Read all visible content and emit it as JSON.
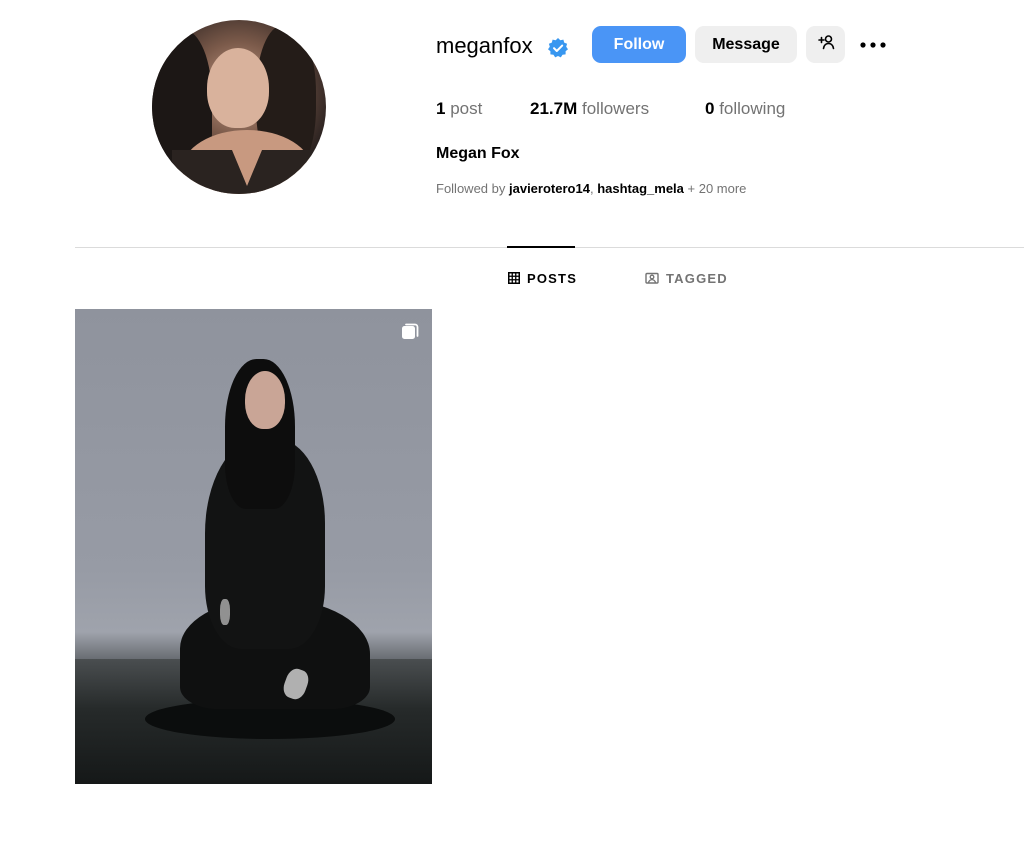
{
  "profile": {
    "username": "meganfox",
    "verified": true,
    "full_name": "Megan Fox",
    "avatar_alt": "meganfox profile picture"
  },
  "actions": {
    "follow_label": "Follow",
    "message_label": "Message",
    "add_user_icon": "person-add-icon",
    "more_icon": "more-options-icon"
  },
  "stats": {
    "posts_count": "1",
    "posts_label": "post",
    "followers_count": "21.7M",
    "followers_label": "followers",
    "following_count": "0",
    "following_label": "following"
  },
  "followed_by": {
    "prefix": "Followed by",
    "accounts": [
      "javierotero14",
      "hashtag_mela"
    ],
    "separator": ",",
    "more": "+ 20 more"
  },
  "tabs": [
    {
      "label": "POSTS",
      "icon": "grid-icon",
      "active": true
    },
    {
      "label": "TAGGED",
      "icon": "tagged-icon",
      "active": false
    }
  ],
  "posts": [
    {
      "type": "carousel",
      "icon": "multiple-images-icon"
    }
  ],
  "colors": {
    "accent": "#4a95f6",
    "secondary_button": "#efefef",
    "muted_text": "#737373",
    "divider": "#dbdbdb"
  }
}
